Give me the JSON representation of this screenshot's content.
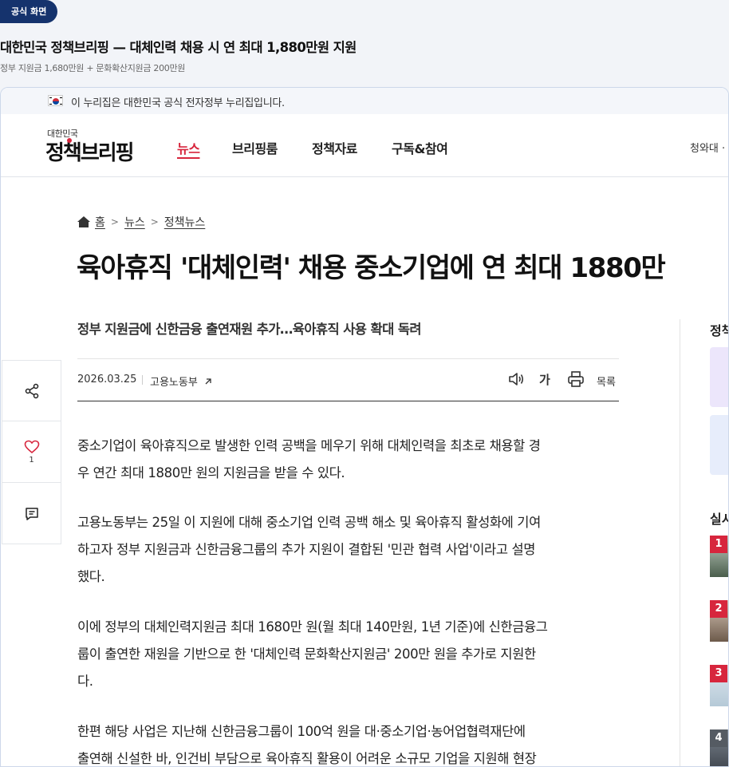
{
  "badge": "공식 화면",
  "page_heading": "대한민국 정책브리핑 — 대체인력 채용 시 연 최대 1,880만원 지원",
  "page_subheading": "정부 지원금 1,680만원 + 문화확산지원금 200만원",
  "gov_notice": "이 누리집은 대한민국 공식 전자정부 누리집입니다.",
  "logo": {
    "small": "대한민국",
    "main": "정책브리핑"
  },
  "nav": [
    {
      "label": "뉴스"
    },
    {
      "label": "브리핑룸"
    },
    {
      "label": "정책자료"
    },
    {
      "label": "구독&참여"
    }
  ],
  "header_right": "청와대 ·",
  "breadcrumb": [
    {
      "label": "홈"
    },
    {
      "label": "뉴스"
    },
    {
      "label": "정책뉴스"
    }
  ],
  "article": {
    "title": "육아휴직 '대체인력' 채용 중소기업에 연 최대 1880만",
    "subtitle": "정부 지원금에 신한금융 출연재원 추가…육아휴직 사용 확대 독려",
    "date": "2026.03.25",
    "department": "고용노동부",
    "font_label": "가",
    "list_label": "목록",
    "paragraphs": [
      [
        "중소기업이 육아휴직으로 발생한 인력 공백을 메우기 위해 대체인력을 최초로 채용할 경",
        "우 연간 최대 1880만 원의 지원금을 받을 수 있다."
      ],
      [
        "고용노동부는 25일 이 지원에 대해 중소기업 인력 공백 해소 및 육아휴직 활성화에 기여",
        "하고자 정부 지원금과 신한금융그룹의 추가 지원이 결합된 '민관 협력 사업'이라고 설명",
        "했다."
      ],
      [
        "이에 정부의 대체인력지원금 최대 1680만 원(월 최대 140만원, 1년 기준)에 신한금융그",
        "룹이 출연한 재원을 기반으로 한 '대체인력 문화확산지원금' 200만 원을 추가로 지원한",
        "다."
      ],
      [
        "한편 해당 사업은 지난해 신한금융그룹이 100억 원을 대·중소기업·농어업협력재단에",
        "출연해 신설한 바, 인건비 부담으로 육아휴직 활용이 어려운 소규모 기업을 지원해 현장"
      ]
    ]
  },
  "share_rail": {
    "like_count": "1"
  },
  "sidebar": {
    "section1_title": "정책",
    "section2_title": "실시",
    "ranks": [
      "1",
      "2",
      "3",
      "4"
    ]
  }
}
